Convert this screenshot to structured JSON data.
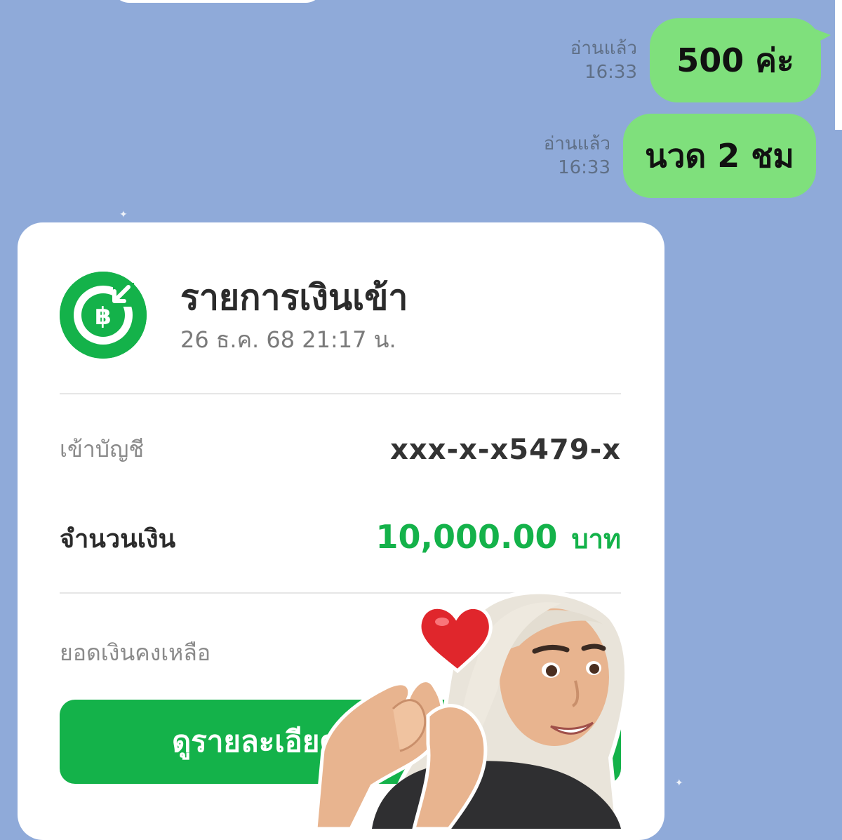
{
  "messages": [
    {
      "read_label": "อ่านแล้ว",
      "time": "16:33",
      "text": "500 ค่ะ"
    },
    {
      "read_label": "อ่านแล้ว",
      "time": "16:33",
      "text": "นวด 2 ชม"
    }
  ],
  "transaction_card": {
    "icon": "baht-incoming-icon",
    "title": "รายการเงินเข้า",
    "datetime": "26 ธ.ค. 68 21:17  น.",
    "account_label": "เข้าบัญชี",
    "account_value": "xxx-x-x5479-x",
    "amount_label": "จำนวนเงิน",
    "amount_value": "10,000.00",
    "amount_unit": "บาท",
    "balance_label": "ยอดเงินคงเหลือ",
    "button_label": "ดูรายละเอียด ทK"
  },
  "colors": {
    "chat_background": "#8faad9",
    "outgoing_bubble": "#7fe07c",
    "accent_green": "#14b24a"
  },
  "sticker": {
    "icon": "heart-hands-avatar-sticker"
  }
}
